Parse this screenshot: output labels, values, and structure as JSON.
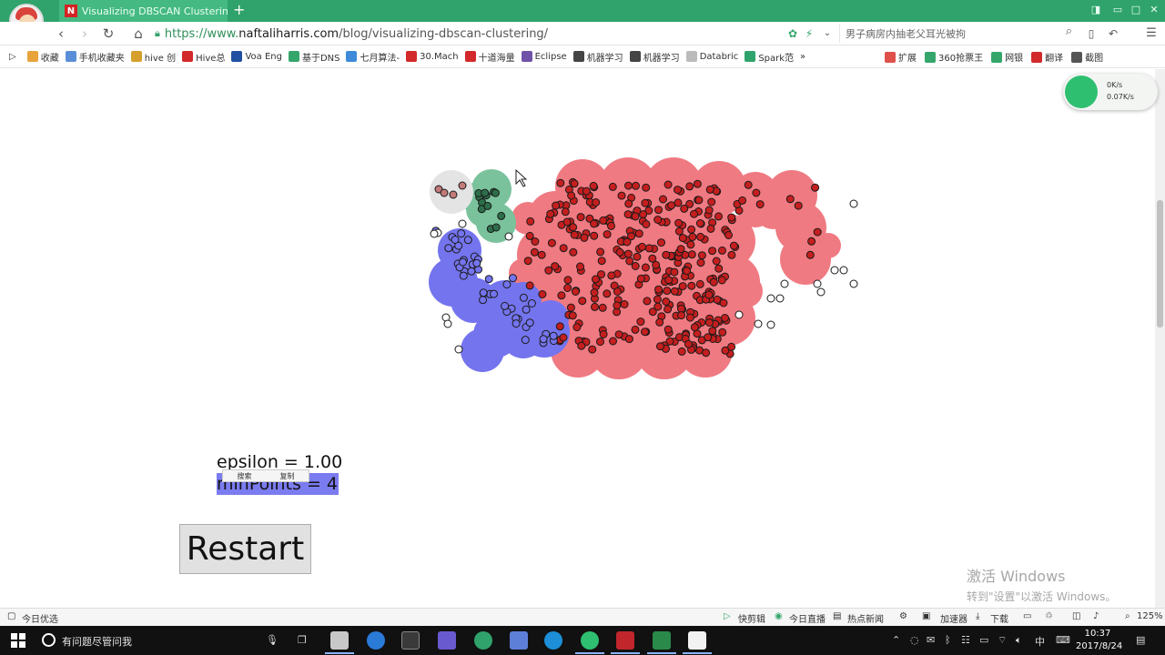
{
  "browser": {
    "tab_title": "Visualizing DBSCAN Clusterin",
    "favicon_letter": "N",
    "new_tab": "+",
    "url_scheme": "https://www.",
    "url_host": "naftaliharris.com",
    "url_path": "/blog/visualizing-dbscan-clustering/",
    "search_text": "男子病房内抽老父耳光被拘"
  },
  "bookmarks": [
    {
      "label": "收藏",
      "color": "#e8a33a"
    },
    {
      "label": "手机收藏夹",
      "color": "#5a8fd8"
    },
    {
      "label": "hive 创",
      "color": "#d59f2c"
    },
    {
      "label": "Hive总",
      "color": "#d22a2a"
    },
    {
      "label": "Voa Eng",
      "color": "#1f4fa0"
    },
    {
      "label": "基于DNS",
      "color": "#35a66b"
    },
    {
      "label": "七月算法-",
      "color": "#3d8bd9"
    },
    {
      "label": "30.Mach",
      "color": "#d22a2a"
    },
    {
      "label": "十道海量",
      "color": "#d22a2a"
    },
    {
      "label": "Eclipse",
      "color": "#7052a8"
    },
    {
      "label": "机器学习",
      "color": "#444444"
    },
    {
      "label": "机器学习",
      "color": "#444444"
    },
    {
      "label": "Databric",
      "color": "#bbbbbb"
    },
    {
      "label": "Spark范",
      "color": "#2fa36b"
    },
    {
      "label": "»",
      "color": ""
    }
  ],
  "bookmarks_right": [
    {
      "label": "扩展",
      "color": "#e0504a"
    },
    {
      "label": "360抢票王",
      "color": "#35a66b"
    },
    {
      "label": "网银",
      "color": "#35a66b"
    },
    {
      "label": "翻译",
      "color": "#d22a2a"
    },
    {
      "label": "截图",
      "color": "#555555"
    }
  ],
  "speed_widget": {
    "down": "0K/s",
    "up": "0.07K/s"
  },
  "params": {
    "epsilon_line": "epsilon = 1.00",
    "minpoints_line": "minPoints = 4"
  },
  "popup": {
    "search": "搜索",
    "copy": "复制"
  },
  "restart_label": "Restart",
  "activation": {
    "line1": "激活 Windows",
    "line2": "转到\"设置\"以激活 Windows。"
  },
  "statusbar": {
    "left": "今日优选",
    "items": [
      "快剪辑",
      "今日直播",
      "热点新闻"
    ],
    "accel": "加速器",
    "download": "下载",
    "zoom": "125%"
  },
  "taskbar": {
    "search_placeholder": "有问题尽管问我",
    "time": "10:37",
    "date": "2017/8/24",
    "ime": "中"
  },
  "colors": {
    "cluster_red": "#f07a82",
    "cluster_blue": "#7474ee",
    "cluster_green": "#7ac29c",
    "cluster_gray": "#e4e4e4",
    "point_red": "#c41e1e",
    "browser_green": "#2fa36b"
  }
}
